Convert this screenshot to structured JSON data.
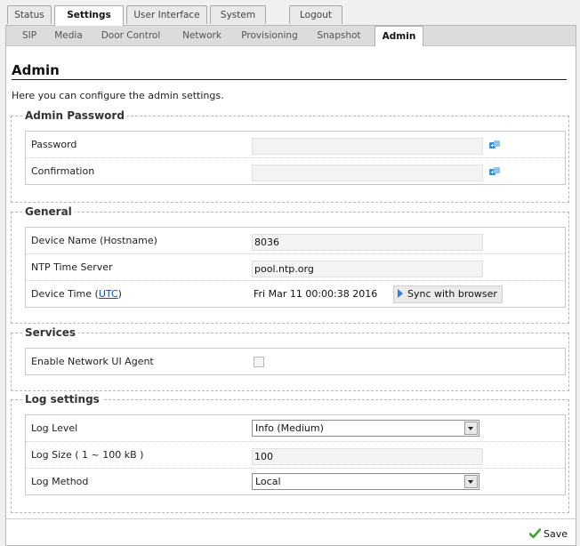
{
  "top_tabs": [
    {
      "label": "Status",
      "active": false
    },
    {
      "label": "Settings",
      "active": true
    },
    {
      "label": "User Interface",
      "active": false
    },
    {
      "label": "System",
      "active": false
    },
    {
      "label": "Logout",
      "active": false
    }
  ],
  "sub_tabs": [
    {
      "label": "SIP",
      "active": false
    },
    {
      "label": "Media",
      "active": false
    },
    {
      "label": "Door Control",
      "active": false
    },
    {
      "label": "Network",
      "active": false
    },
    {
      "label": "Provisioning",
      "active": false
    },
    {
      "label": "Snapshot",
      "active": false
    },
    {
      "label": "Admin",
      "active": true
    }
  ],
  "page": {
    "title": "Admin",
    "intro": "Here you can configure the admin settings."
  },
  "admin_password": {
    "legend": "Admin Password",
    "password_label": "Password",
    "password_value": "",
    "confirmation_label": "Confirmation",
    "confirmation_value": ""
  },
  "general": {
    "legend": "General",
    "device_name_label": "Device Name (Hostname)",
    "device_name_value": "8036",
    "ntp_label": "NTP Time Server",
    "ntp_value": "pool.ntp.org",
    "device_time_label": "Device Time (",
    "device_time_link": "UTC",
    "device_time_label_end": ")",
    "device_time_value": "Fri Mar 11 00:00:38 2016",
    "sync_button": "Sync with browser"
  },
  "services": {
    "legend": "Services",
    "network_ui_agent_label": "Enable Network UI Agent",
    "network_ui_agent_checked": false
  },
  "log_settings": {
    "legend": "Log settings",
    "log_level_label": "Log Level",
    "log_level_value": "Info (Medium)",
    "log_size_label": "Log Size ( 1 ~ 100 kB )",
    "log_size_value": "100",
    "log_method_label": "Log Method",
    "log_method_value": "Local"
  },
  "footer": {
    "save_label": "Save"
  },
  "colors": {
    "link": "#1a4fa3",
    "sync_arrow": "#2e7de0",
    "save_check": "#3aa329",
    "key_icon": "#3b8fd9"
  }
}
